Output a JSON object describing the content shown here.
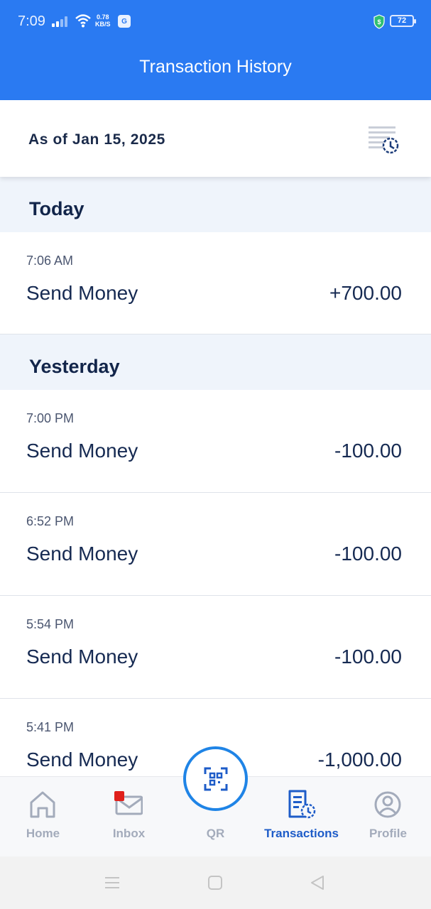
{
  "status_bar": {
    "time": "7:09",
    "net_speed_value": "0.78",
    "net_speed_unit": "KB/S",
    "app_icon_letter": "G",
    "battery_level": "72"
  },
  "header": {
    "title": "Transaction History"
  },
  "as_of": {
    "label": "As of Jan 15, 2025"
  },
  "sections": [
    {
      "title": "Today",
      "transactions": [
        {
          "time": "7:06 AM",
          "name": "Send Money",
          "amount": "+700.00"
        }
      ]
    },
    {
      "title": "Yesterday",
      "transactions": [
        {
          "time": "7:00 PM",
          "name": "Send Money",
          "amount": "-100.00"
        },
        {
          "time": "6:52 PM",
          "name": "Send Money",
          "amount": "-100.00"
        },
        {
          "time": "5:54 PM",
          "name": "Send Money",
          "amount": "-100.00"
        },
        {
          "time": "5:41 PM",
          "name": "Send Money",
          "amount": "-1,000.00"
        }
      ]
    }
  ],
  "bottom_nav": {
    "home": "Home",
    "inbox": "Inbox",
    "qr": "QR",
    "transactions": "Transactions",
    "profile": "Profile",
    "active": "transactions"
  },
  "colors": {
    "header_blue": "#2a7af2",
    "active_nav": "#1e5cc8",
    "section_bg": "#eff4fb",
    "text_dark": "#162a52",
    "badge_red": "#e0201b"
  }
}
